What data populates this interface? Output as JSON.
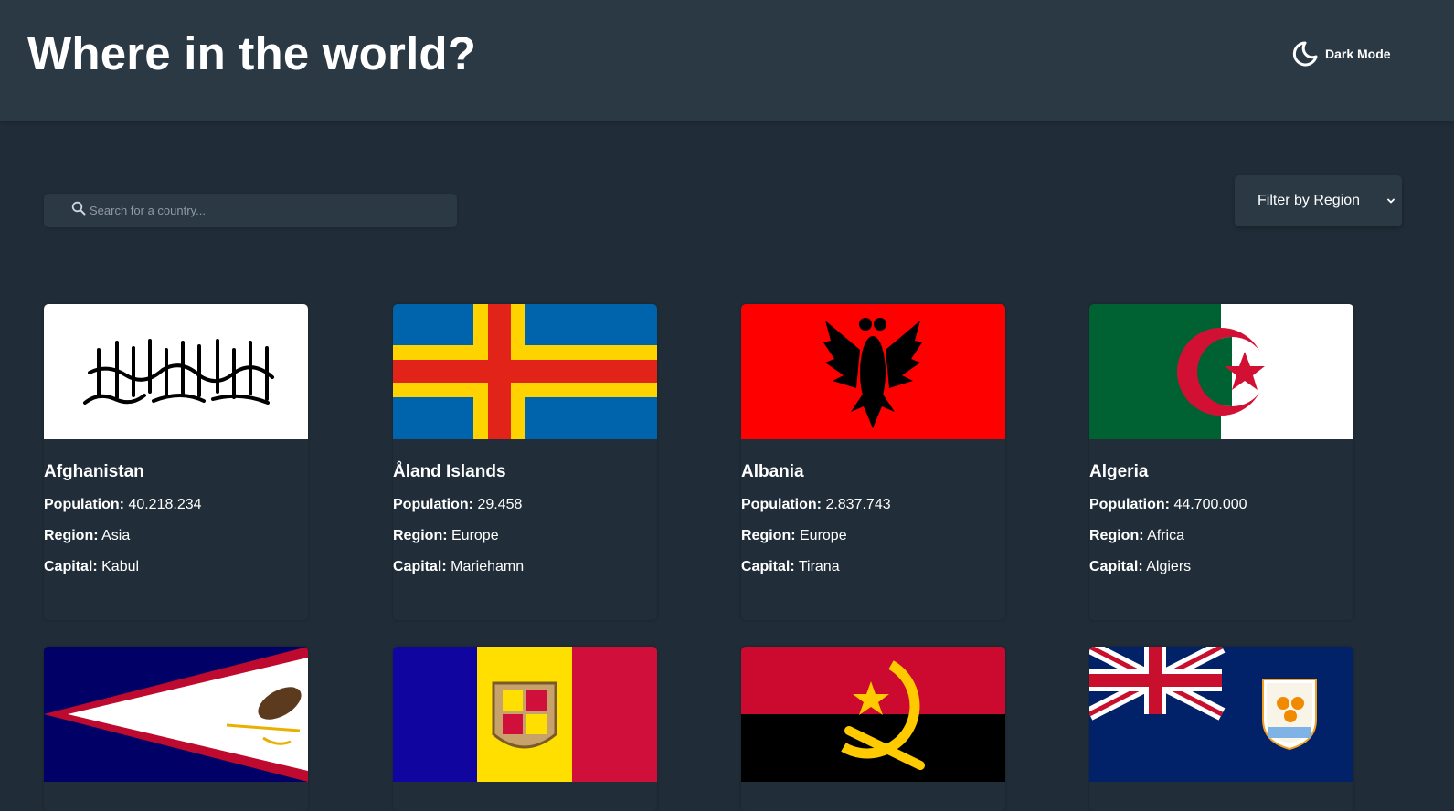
{
  "header": {
    "title": "Where in the world?",
    "theme_toggle_label": "Dark Mode",
    "theme_icon": "moon-icon"
  },
  "search": {
    "placeholder": "Search for a country...",
    "value": "",
    "icon": "search-icon"
  },
  "filter": {
    "label": "Filter by Region",
    "icon": "chevron-down-icon"
  },
  "stat_labels": {
    "population": "Population:",
    "region": "Region:",
    "capital": "Capital:"
  },
  "countries": [
    {
      "name": "Afghanistan",
      "population": "40.218.234",
      "region": "Asia",
      "capital": "Kabul",
      "flag": "afghanistan-flag"
    },
    {
      "name": "Åland Islands",
      "population": "29.458",
      "region": "Europe",
      "capital": "Mariehamn",
      "flag": "aland-islands-flag"
    },
    {
      "name": "Albania",
      "population": "2.837.743",
      "region": "Europe",
      "capital": "Tirana",
      "flag": "albania-flag"
    },
    {
      "name": "Algeria",
      "population": "44.700.000",
      "region": "Africa",
      "capital": "Algiers",
      "flag": "algeria-flag"
    },
    {
      "flag": "american-samoa-flag"
    },
    {
      "flag": "andorra-flag"
    },
    {
      "flag": "angola-flag"
    },
    {
      "flag": "anguilla-flag"
    }
  ],
  "colors": {
    "background": "#202c37",
    "elements": "#2b3945",
    "text": "#ffffff"
  }
}
